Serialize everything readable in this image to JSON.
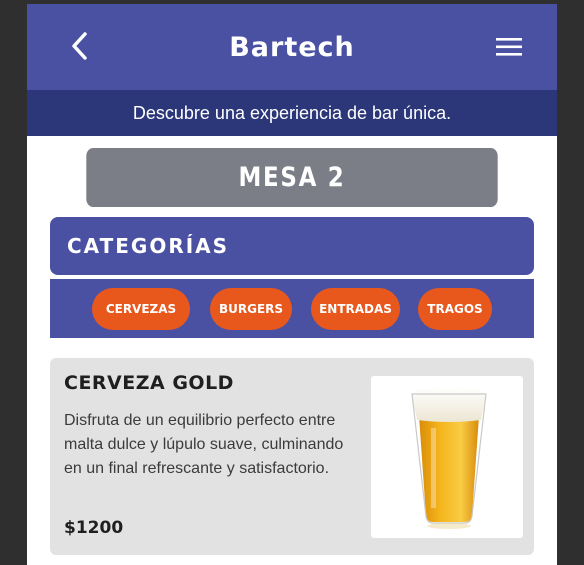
{
  "header": {
    "brand": "Bartech",
    "back_icon": "chevron-left-icon",
    "menu_icon": "hamburger-menu-icon",
    "tagline": "Descubre una experiencia de bar única."
  },
  "table": {
    "label": "MESA 2"
  },
  "categories": {
    "title": "CATEGORÍAS",
    "items": [
      {
        "label": "CERVEZAS"
      },
      {
        "label": "BURGERS"
      },
      {
        "label": "ENTRADAS"
      },
      {
        "label": "TRAGOS"
      }
    ]
  },
  "products": [
    {
      "name": "CERVEZA GOLD",
      "description": "Disfruta de un equilibrio perfecto entre malta dulce y lúpulo suave, culminando en un final refrescante y satisfactorio.",
      "price": "$1200",
      "image_icon": "beer-glass-image"
    }
  ],
  "colors": {
    "primary": "#4a51a3",
    "primary_dark": "#2c3779",
    "accent": "#e8581d",
    "table_bg": "#7b7e87",
    "card_bg": "#e2e2e3"
  }
}
